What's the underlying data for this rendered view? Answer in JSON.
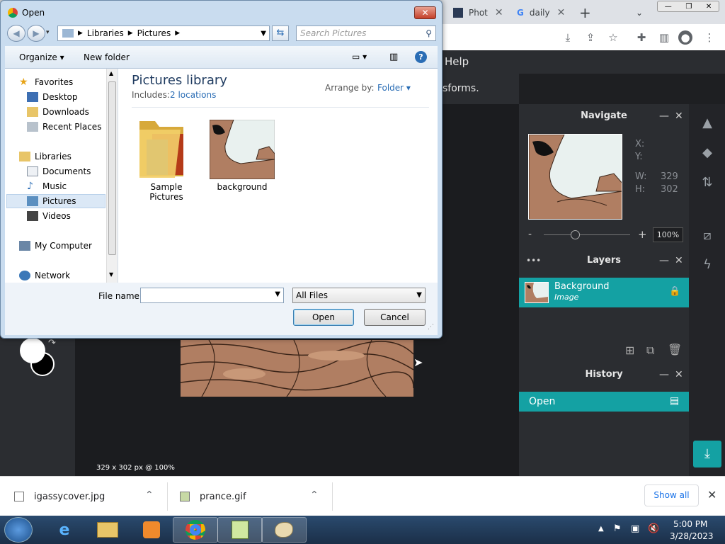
{
  "browser": {
    "tabs": [
      {
        "label": "Phot"
      },
      {
        "label": "daily"
      }
    ],
    "new_tab": "+"
  },
  "app": {
    "menu_help": "Help",
    "hint_text": "sforms.",
    "status": "329 x 302 px @ 100%"
  },
  "navigate_panel": {
    "title": "Navigate",
    "x_label": "X:",
    "y_label": "Y:",
    "w_label": "W:",
    "h_label": "H:",
    "w_value": "329",
    "h_value": "302",
    "zoom": "100%",
    "zoom_minus": "-",
    "zoom_plus": "+"
  },
  "layers_panel": {
    "title": "Layers",
    "more": "•••",
    "layer_name": "Background",
    "layer_type": "Image"
  },
  "history_panel": {
    "title": "History",
    "entry": "Open"
  },
  "dialog": {
    "title": "Open",
    "breadcrumb": [
      "Libraries",
      "Pictures"
    ],
    "search_placeholder": "Search Pictures",
    "organize": "Organize ▾",
    "new_folder": "New folder",
    "library_title": "Pictures library",
    "includes_label": "Includes:",
    "includes_link": "2 locations",
    "arrange_label": "Arrange by:",
    "arrange_value": "Folder ▾",
    "nav": {
      "favorites": "Favorites",
      "desktop": "Desktop",
      "downloads": "Downloads",
      "recent": "Recent Places",
      "libraries": "Libraries",
      "documents": "Documents",
      "music": "Music",
      "pictures": "Pictures",
      "videos": "Videos",
      "computer": "My Computer",
      "network": "Network"
    },
    "items": [
      {
        "label": "Sample Pictures"
      },
      {
        "label": "background"
      }
    ],
    "filename_label": "File name:",
    "filename_value": "",
    "filetype_value": "All Files",
    "open_button": "Open",
    "cancel_button": "Cancel"
  },
  "downloads": {
    "items": [
      {
        "name": "igassycover.jpg"
      },
      {
        "name": "prance.gif"
      }
    ],
    "show_all": "Show all"
  },
  "taskbar": {
    "time": "5:00 PM",
    "date": "3/28/2023"
  },
  "colors": {
    "accent": "#14a1a3",
    "panel": "#2b2d31"
  }
}
